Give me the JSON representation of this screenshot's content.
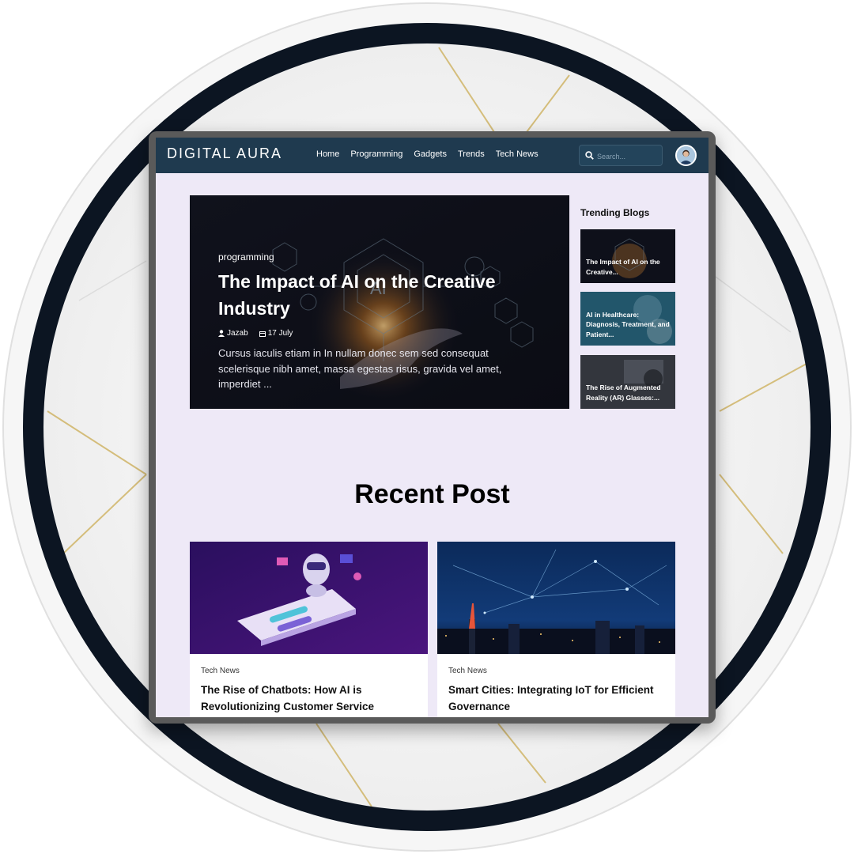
{
  "colors": {
    "nav_bg": "#1f3a4f",
    "page_bg": "#eee9f7",
    "circle_ring": "#0c1522",
    "frame": "#5a5a5a"
  },
  "header": {
    "logo": "DIGITAL AURA",
    "menu": [
      "Home",
      "Programming",
      "Gadgets",
      "Trends",
      "Tech News"
    ],
    "search_placeholder": "Search...",
    "search_icon": "search-icon",
    "avatar_icon": "user-avatar"
  },
  "hero": {
    "category": "programming",
    "title": "The Impact of AI on the Creative Industry",
    "author": "Jazab",
    "date": "17 July",
    "author_icon": "user-icon",
    "date_icon": "calendar-icon",
    "excerpt": "Cursus iaculis etiam in In nullam donec sem sed consequat scelerisque nibh amet, massa egestas risus, gravida vel amet, imperdiet ..."
  },
  "trending": {
    "title": "Trending Blogs",
    "items": [
      {
        "label": "The Impact of AI on the Creative..."
      },
      {
        "label": "AI in Healthcare: Diagnosis, Treatment, and Patient..."
      },
      {
        "label": "The Rise of Augmented Reality (AR) Glasses:..."
      }
    ]
  },
  "recent": {
    "heading": "Recent Post",
    "posts": [
      {
        "category": "Tech News",
        "title": "The Rise of Chatbots: How AI is Revolutionizing Customer Service"
      },
      {
        "category": "Tech News",
        "title": "Smart Cities: Integrating IoT for Efficient Governance"
      }
    ]
  }
}
